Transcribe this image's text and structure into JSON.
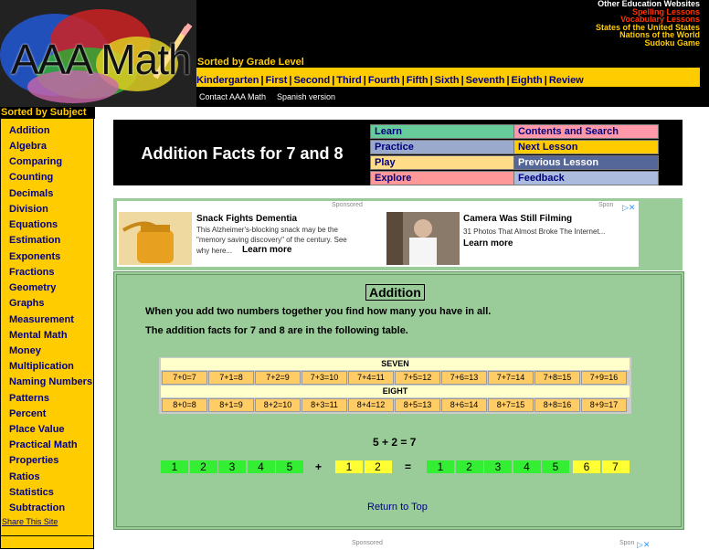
{
  "colors": {
    "yellow": "#ffcc00",
    "green_bg": "#99cc99",
    "navy": "#000080",
    "other_red": "#ff3300",
    "other_yellow": "#ffcc00"
  },
  "header": {
    "logo_text": "AAA Math",
    "other_links": [
      {
        "label": "Other Education Websites",
        "color": "#ffffff"
      },
      {
        "label": "Spelling Lessons",
        "color": "#ff3300"
      },
      {
        "label": "Vocabulary Lessons",
        "color": "#ff3300"
      },
      {
        "label": "States of the United States",
        "color": "#ffcc00"
      },
      {
        "label": "Nations of the World",
        "color": "#ffcc00"
      },
      {
        "label": "Sudoku Game",
        "color": "#ffcc00"
      }
    ],
    "sorted_grade": "Sorted by Grade Level",
    "grades": [
      "Kindergarten",
      "First",
      "Second",
      "Third",
      "Fourth",
      "Fifth",
      "Sixth",
      "Seventh",
      "Eighth",
      "Review"
    ],
    "contact": "Contact AAA Math",
    "spanish": "Spanish version"
  },
  "sidebar": {
    "title": "Sorted by Subject",
    "items": [
      "Addition",
      "Algebra",
      "Comparing",
      "Counting",
      "Decimals",
      "Division",
      "Equations",
      "Estimation",
      "Exponents",
      "Fractions",
      "Geometry",
      "Graphs",
      "Measurement",
      "Mental Math",
      "Money",
      "Multiplication",
      "Naming Numbers",
      "Patterns",
      "Percent",
      "Place Value",
      "Practical Math",
      "Properties",
      "Ratios",
      "Statistics",
      "Subtraction"
    ],
    "share": "Share This Site"
  },
  "lesson": {
    "title": "Addition Facts for 7 and 8",
    "nav": [
      {
        "label": "Learn",
        "bg": "#66cc99"
      },
      {
        "label": "Contents and Search",
        "bg": "#ff99aa"
      },
      {
        "label": "Practice",
        "bg": "#99aacc"
      },
      {
        "label": "Next Lesson",
        "bg": "#ffcc00"
      },
      {
        "label": "Play",
        "bg": "#ffdd88"
      },
      {
        "label": "Previous Lesson",
        "bg": "#556699"
      },
      {
        "label": "Explore",
        "bg": "#ff9999"
      },
      {
        "label": "Feedback",
        "bg": "#aabbdd"
      }
    ]
  },
  "ads": {
    "sponsored": "Sponsored",
    "sponsored_short": "Spon",
    "ad1": {
      "title": "Snack Fights Dementia",
      "text_line1": "This Alzheimer's-blocking snack may be the",
      "text_line2": "\"memory saving discovery\" of the century. See",
      "text_line3": "why here...",
      "cta": "Learn more"
    },
    "ad2": {
      "title": "Camera Was Still Filming",
      "text": "31 Photos That Almost Broke The Internet...",
      "cta": "Learn more"
    }
  },
  "content": {
    "section_title": "Addition",
    "para1": "When you add two numbers together you find how many you have in all.",
    "para2": "The addition facts for 7 and 8 are in the following table.",
    "seven_header": "SEVEN",
    "seven_facts": [
      "7+0=7",
      "7+1=8",
      "7+2=9",
      "7+3=10",
      "7+4=11",
      "7+5=12",
      "7+6=13",
      "7+7=14",
      "7+8=15",
      "7+9=16"
    ],
    "eight_header": "EIGHT",
    "eight_facts": [
      "8+0=8",
      "8+1=9",
      "8+2=10",
      "8+3=11",
      "8+4=12",
      "8+5=13",
      "8+6=14",
      "8+7=15",
      "8+8=16",
      "8+9=17"
    ],
    "equation": "5 + 2 = 7",
    "plus": "+",
    "equals": "=",
    "left_blocks": [
      "1",
      "2",
      "3",
      "4",
      "5"
    ],
    "mid_blocks": [
      "1",
      "2"
    ],
    "result_blocks_green": [
      "1",
      "2",
      "3",
      "4",
      "5"
    ],
    "result_blocks_yellow": [
      "6",
      "7"
    ],
    "return_top": "Return to Top"
  }
}
